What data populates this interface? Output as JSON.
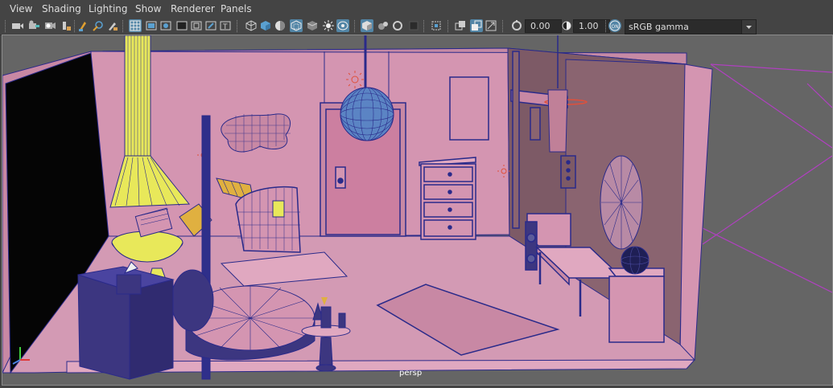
{
  "menu": [
    "View",
    "Shading",
    "Lighting",
    "Show",
    "Renderer",
    "Panels"
  ],
  "toolbar": {
    "exposure": "0.00",
    "gamma": "1.00",
    "colorspace": "sRGB gamma",
    "icons": [
      "select-camera-icon",
      "camera-attributes-icon",
      "bookmark-icon",
      "image-plane-icon",
      "two-d-pan-icon",
      "grease-pencil-icon",
      "grid-icon",
      "film-gate-icon",
      "resolution-gate-icon",
      "gate-mask-icon",
      "field-chart-icon",
      "safe-action-icon",
      "safe-title-icon",
      "wireframe-icon",
      "smooth-shade-icon",
      "default-material-icon",
      "textured-icon",
      "use-all-lights-icon",
      "shadows-icon",
      "xray-icon",
      "xray-joints-icon",
      "xray-active-icon",
      "ambient-occlusion-icon",
      "motion-blur-icon",
      "anti-aliasing-icon",
      "depth-of-field-icon",
      "isolate-select-icon",
      "exposure-icon",
      "gamma-icon",
      "color-management-icon"
    ]
  },
  "viewport": {
    "camera_label": "persp"
  },
  "colors": {
    "wall": "#d495b1",
    "wireframe": "#2a2a8a",
    "selection": "#ecec4a",
    "background": "#656565",
    "accent": "#5285a6"
  }
}
